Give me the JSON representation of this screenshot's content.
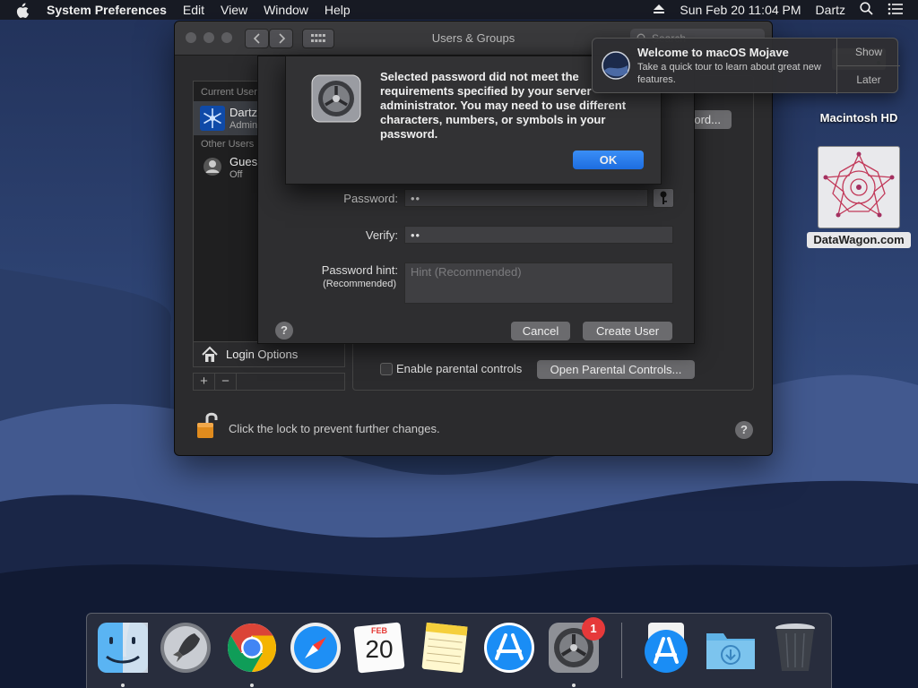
{
  "menubar": {
    "app_name": "System Preferences",
    "menus": [
      "Edit",
      "View",
      "Window",
      "Help"
    ],
    "datetime": "Sun Feb 20  11:04 PM",
    "user": "Dartz"
  },
  "window": {
    "title": "Users & Groups",
    "search_placeholder": "Search",
    "sidebar": {
      "current_users_header": "Current Users",
      "current_user_name": "Dartz",
      "current_user_role": "Admin",
      "other_users_header": "Other Users",
      "guest_name": "Guest User",
      "guest_status": "Off"
    },
    "login_options_label": "Login Options",
    "add_label": "+",
    "remove_label": "−",
    "change_password_label": "Change Password...",
    "parental_checkbox_label": "Enable parental controls",
    "open_parental_label": "Open Parental Controls...",
    "lock_text": "Click the lock to prevent further changes.",
    "help_label": "?"
  },
  "sheet": {
    "password_label": "Password:",
    "password_value": "••",
    "verify_label": "Verify:",
    "verify_value": "••",
    "hint_label": "Password hint:",
    "hint_sublabel": "(Recommended)",
    "hint_placeholder": "Hint (Recommended)",
    "help_label": "?",
    "cancel_label": "Cancel",
    "create_label": "Create User"
  },
  "alert": {
    "message": "Selected password did not meet the requirements specified by your server administrator. You may need to use different characters, numbers, or symbols in your password.",
    "ok_label": "OK"
  },
  "notification": {
    "title": "Welcome to macOS Mojave",
    "body": "Take a quick tour to learn about great new features.",
    "show_label": "Show",
    "later_label": "Later"
  },
  "desktop": {
    "hd_label": "Macintosh HD",
    "datawagon_label": "DataWagon.com"
  },
  "dock": {
    "calendar_month": "FEB",
    "calendar_day": "20",
    "prefs_badge": "1",
    "items": [
      "finder-icon",
      "launchpad-icon",
      "chrome-icon",
      "safari-icon",
      "calendar-icon",
      "notes-icon",
      "app-store-icon",
      "system-preferences-icon",
      "app-store-download-icon",
      "downloads-folder-icon",
      "trash-icon"
    ]
  },
  "colors": {
    "accent": "#1d6de0",
    "badge": "#e6393a"
  }
}
